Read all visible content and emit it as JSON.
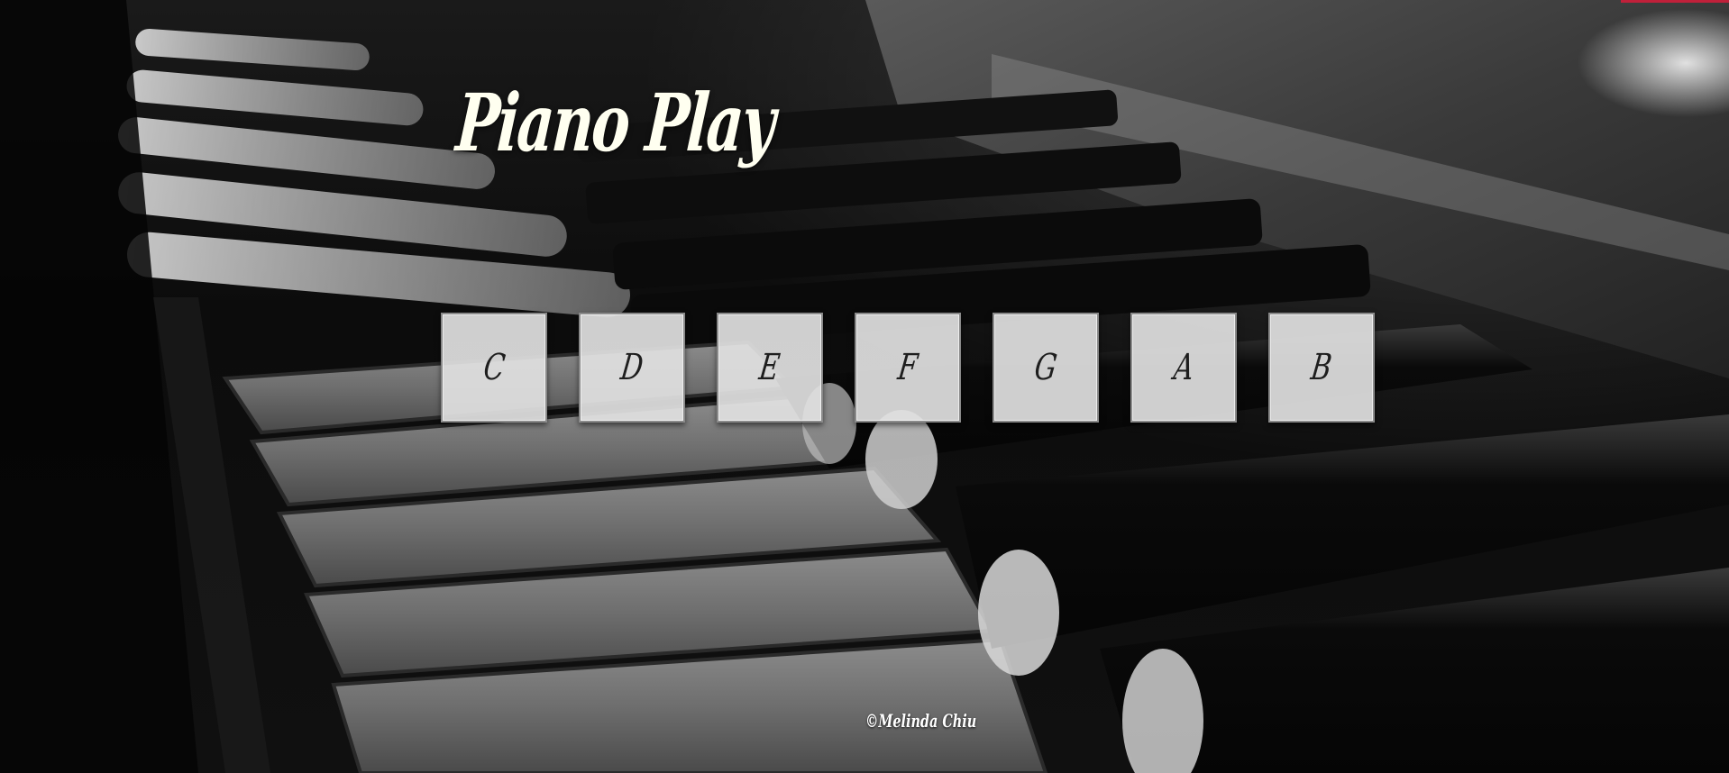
{
  "page": {
    "title": "Piano Play",
    "credit": "©Melinda Chiu"
  },
  "notes": [
    {
      "label": "C"
    },
    {
      "label": "D"
    },
    {
      "label": "E"
    },
    {
      "label": "F"
    },
    {
      "label": "G"
    },
    {
      "label": "A"
    },
    {
      "label": "B"
    }
  ],
  "colors": {
    "title": "#fffff0",
    "button_bg": "#e1e1e1",
    "button_border": "#8a8a8a",
    "note_text": "#1e1e1e",
    "accent_line": "#c0203a"
  },
  "background": {
    "icon": "piano-keys-photo"
  }
}
